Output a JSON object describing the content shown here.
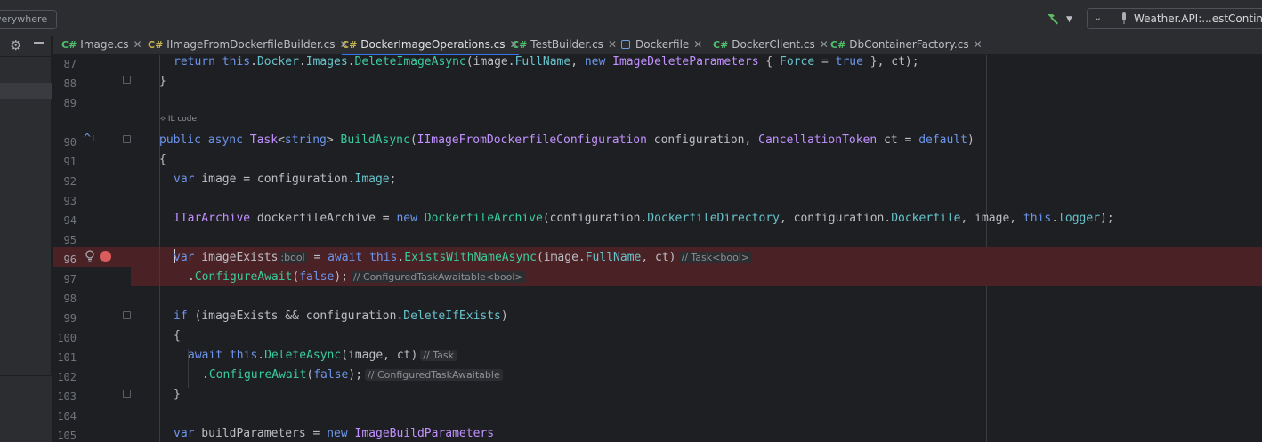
{
  "toolbar": {
    "search_text": "verywhere",
    "run_config_label": "Weather.API:...estContiners"
  },
  "tabs": [
    {
      "icon": "C#",
      "label": "Image.cs"
    },
    {
      "icon": "C#",
      "label": "IImageFromDockerfileBuilder.cs"
    },
    {
      "icon": "C#",
      "label": "DockerImageOperations.cs"
    },
    {
      "icon": "C#",
      "label": "TestBuilder.cs"
    },
    {
      "icon": "",
      "label": "Dockerfile"
    },
    {
      "icon": "C#",
      "label": "DockerClient.cs"
    },
    {
      "icon": "C#",
      "label": "DbContainerFactory.cs"
    }
  ],
  "editor": {
    "line_numbers": [
      "87",
      "88",
      "89",
      "90",
      "91",
      "92",
      "93",
      "94",
      "95",
      "96",
      "97",
      "98",
      "99",
      "100",
      "101",
      "102",
      "103",
      "104",
      "105"
    ],
    "il_code_label": "IL code",
    "hints": {
      "image_exists_type": ":bool",
      "line96_type": "// Task<bool>",
      "line97_type": "// ConfiguredTaskAwaitable<bool>",
      "line101_type": "// Task",
      "line102_type": "// ConfiguredTaskAwaitable"
    },
    "code": {
      "l87": [
        "return",
        "this",
        ".",
        "Docker",
        ".",
        "Images",
        ".",
        "DeleteImageAsync",
        "(image.",
        "FullName",
        ", ",
        "new",
        "ImageDeleteParameters",
        " { ",
        "Force",
        " = ",
        "true",
        " }, ct);"
      ],
      "l88": "}",
      "l90": [
        "public",
        "async",
        "Task",
        "<",
        "string",
        "> ",
        "BuildAsync",
        "(",
        "IImageFromDockerfileConfiguration",
        " configuration, ",
        "CancellationToken",
        " ct = ",
        "default",
        ")"
      ],
      "l91": "{",
      "l92": [
        "var",
        " image = configuration.",
        "Image",
        ";"
      ],
      "l94": [
        "ITarArchive",
        " dockerfileArchive = ",
        "new",
        " ",
        "DockerfileArchive",
        "(configuration.",
        "DockerfileDirectory",
        ", configuration.",
        "Dockerfile",
        ", image, ",
        "this",
        ".",
        "logger",
        ");"
      ],
      "l96": [
        "var",
        " imageExists",
        " = ",
        "await",
        " ",
        "this",
        ".",
        "ExistsWithNameAsync",
        "(image.",
        "FullName",
        ", ct)"
      ],
      "l97": [
        ".",
        "ConfigureAwait",
        "(",
        "false",
        ");"
      ],
      "l99": [
        "if",
        " (imageExists && configuration.",
        "DeleteIfExists",
        ")"
      ],
      "l100": "{",
      "l101": [
        "await",
        " ",
        "this",
        ".",
        "DeleteAsync",
        "(image, ct)"
      ],
      "l102": [
        ".",
        "ConfigureAwait",
        "(",
        "false",
        ");"
      ],
      "l103": "}",
      "l105": [
        "var",
        " buildParameters = ",
        "new",
        " ",
        "ImageBuildParameters"
      ]
    }
  },
  "colors": {
    "keyword": "#6c95eb",
    "type": "#c191ff",
    "method": "#39cc9b",
    "property": "#66c3cc",
    "breakpoint": "#db5c5c",
    "accent": "#3574f0"
  }
}
